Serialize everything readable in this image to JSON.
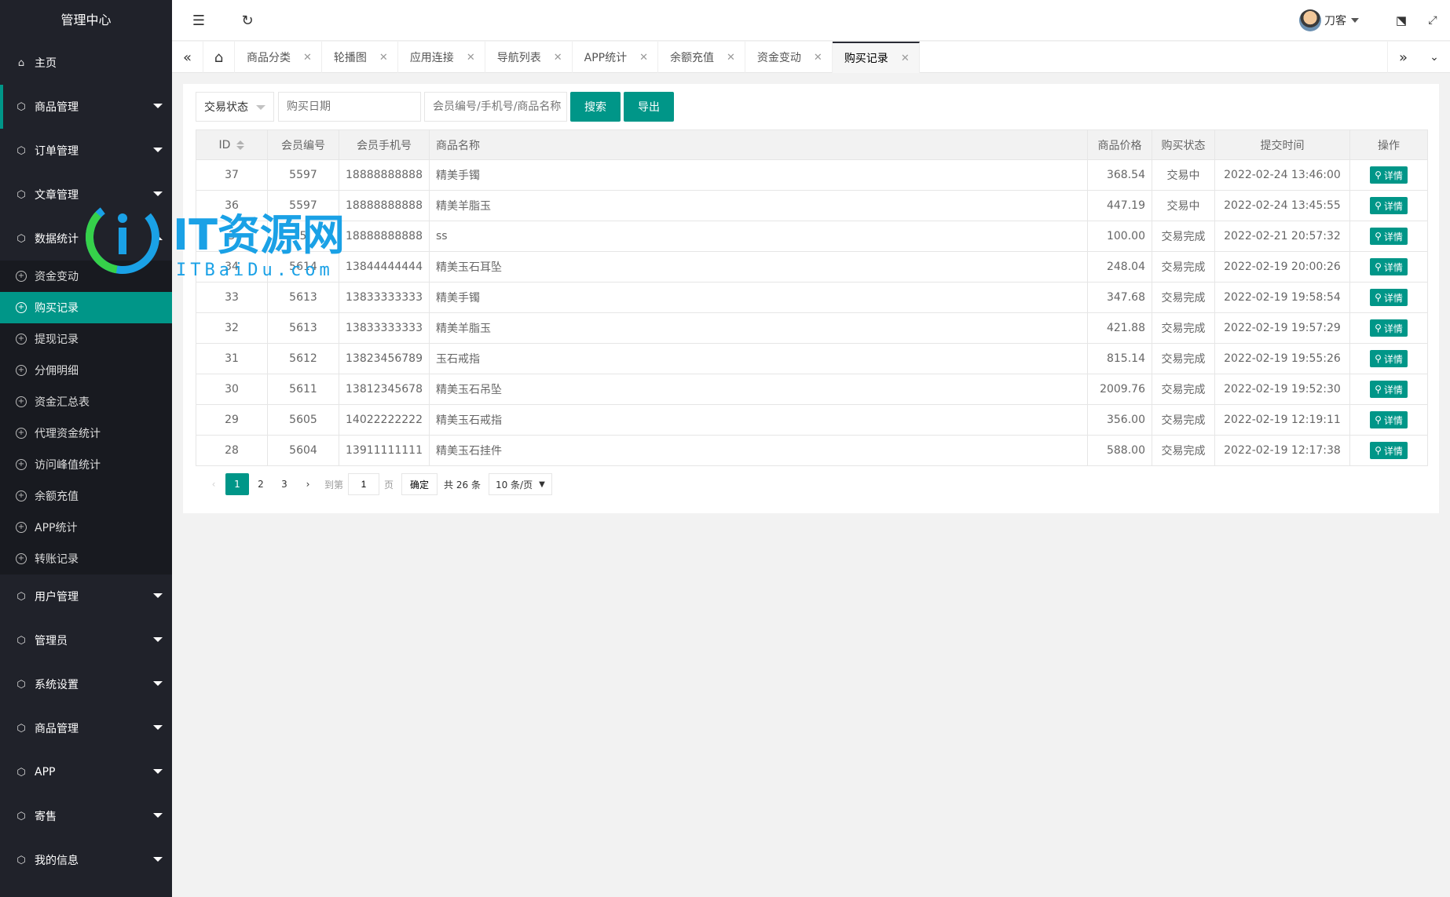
{
  "sidebar": {
    "title": "管理中心",
    "home": "主页",
    "groups_top": [
      "商品管理",
      "订单管理",
      "文章管理"
    ],
    "stats_group": "数据统计",
    "stats_items": [
      "资金变动",
      "购买记录",
      "提现记录",
      "分佣明细",
      "资金汇总表",
      "代理资金统计",
      "访问峰值统计",
      "余额充值",
      "APP统计",
      "转账记录"
    ],
    "groups_bottom": [
      "用户管理",
      "管理员",
      "系统设置",
      "商品管理",
      "APP",
      "寄售",
      "我的信息"
    ]
  },
  "header": {
    "username": "刀客"
  },
  "tabs": [
    "商品分类",
    "轮播图",
    "应用连接",
    "导航列表",
    "APP统计",
    "余额充值",
    "资金变动",
    "购买记录"
  ],
  "toolbar": {
    "status_select": "交易状态",
    "date_placeholder": "购买日期",
    "keyword_placeholder": "会员编号/手机号/商品名称",
    "search_label": "搜索",
    "export_label": "导出"
  },
  "table": {
    "headers": [
      "ID",
      "会员编号",
      "会员手机号",
      "商品名称",
      "商品价格",
      "购买状态",
      "提交时间",
      "操作"
    ],
    "detail_label": "详情",
    "rows": [
      [
        "37",
        "5597",
        "18888888888",
        "精美手镯",
        "368.54",
        "交易中",
        "2022-02-24 13:46:00"
      ],
      [
        "36",
        "5597",
        "18888888888",
        "精美羊脂玉",
        "447.19",
        "交易中",
        "2022-02-24 13:45:55"
      ],
      [
        "3",
        "5",
        "18888888888",
        "ss",
        "100.00",
        "交易完成",
        "2022-02-21 20:57:32"
      ],
      [
        "34",
        "5614",
        "13844444444",
        "精美玉石耳坠",
        "248.04",
        "交易完成",
        "2022-02-19 20:00:26"
      ],
      [
        "33",
        "5613",
        "13833333333",
        "精美手镯",
        "347.68",
        "交易完成",
        "2022-02-19 19:58:54"
      ],
      [
        "32",
        "5613",
        "13833333333",
        "精美羊脂玉",
        "421.88",
        "交易完成",
        "2022-02-19 19:57:29"
      ],
      [
        "31",
        "5612",
        "13823456789",
        "玉石戒指",
        "815.14",
        "交易完成",
        "2022-02-19 19:55:26"
      ],
      [
        "30",
        "5611",
        "13812345678",
        "精美玉石吊坠",
        "2009.76",
        "交易完成",
        "2022-02-19 19:52:30"
      ],
      [
        "29",
        "5605",
        "14022222222",
        "精美玉石戒指",
        "356.00",
        "交易完成",
        "2022-02-19 12:19:11"
      ],
      [
        "28",
        "5604",
        "13911111111",
        "精美玉石挂件",
        "588.00",
        "交易完成",
        "2022-02-19 12:17:38"
      ]
    ]
  },
  "pagination": {
    "pages": [
      "1",
      "2",
      "3"
    ],
    "goto_label": "到第",
    "goto_value": "1",
    "page_unit": "页",
    "confirm_label": "确定",
    "total_label": "共 26 条",
    "page_size": "10 条/页"
  },
  "watermark": {
    "title": "IT资源网",
    "subtitle": "ITBaiDu.com"
  },
  "colors": {
    "accent": "#009688",
    "sidebar": "#20222a"
  }
}
